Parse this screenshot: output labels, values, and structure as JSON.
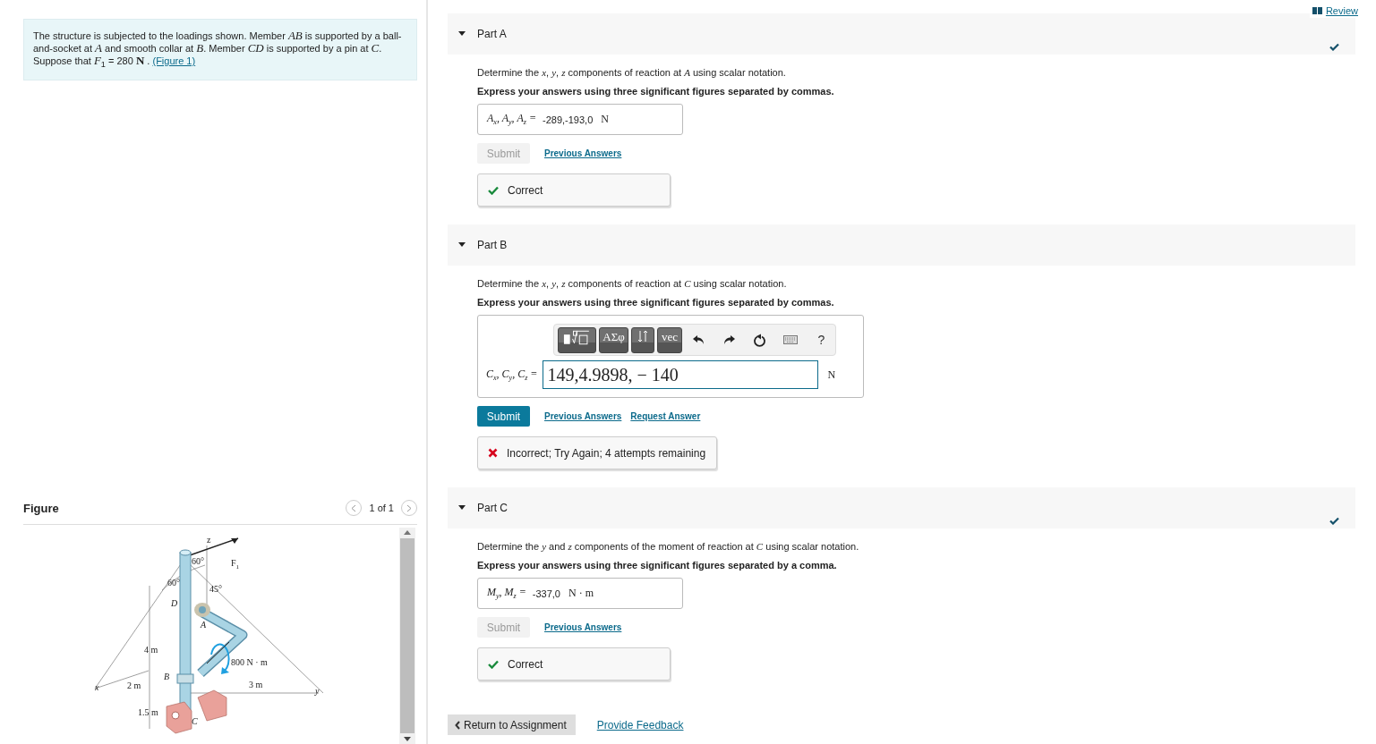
{
  "review": {
    "label": "Review"
  },
  "intro": {
    "text": "The structure is subjected to the loadings shown. Member *AB* is supported by a ball-and-socket at *A* and smooth collar at *B*. Member *CD* is supported by a pin at *C*. Suppose that *F*$_{1}$ = 280 **N** .",
    "link": "(Figure 1)"
  },
  "figure": {
    "title": "Figure",
    "pager": "1 of 1",
    "labels": [
      "z",
      "60°",
      "F$_{1}$",
      "60°",
      "45°",
      "*D*",
      "*A*",
      "4 m",
      "800 N · m",
      "*B*",
      "*x*",
      "2 m",
      "3 m",
      "*y*",
      "1.5 m",
      "*C*"
    ]
  },
  "parts": [
    {
      "title": "Part A",
      "expanded": true,
      "complete": true,
      "prompt": "Determine the *x*, *y*, *z* components of reaction at *A* using scalar notation.",
      "instruction": "Express your answers using three significant figures separated by commas.",
      "answer": {
        "kind": "static",
        "label": "*A*$_{x}$, *A*$_{y}$, *A*$_{z}$ =",
        "value": "-289,-193,0",
        "unit": "N"
      },
      "submit": {
        "label": "Submit",
        "disabled": true
      },
      "links": [
        "Previous Answers"
      ],
      "feedback": {
        "kind": "correct",
        "text": "Correct"
      }
    },
    {
      "title": "Part B",
      "expanded": true,
      "complete": false,
      "prompt": "Determine the *x*, *y*, *z* components of reaction at *C* using scalar notation.",
      "instruction": "Express your answers using three significant figures separated by commas.",
      "answer": {
        "kind": "editor",
        "label": "*C*$_{x}$, *C*$_{y}$, *C*$_{z}$ =",
        "value": "149,4.9898, − 140",
        "unit": "N",
        "toolbar": [
          {
            "kind": "templates"
          },
          {
            "kind": "key",
            "label": "ΑΣφ"
          },
          {
            "kind": "arrows"
          },
          {
            "kind": "key",
            "label": "vec"
          },
          {
            "kind": "undo"
          },
          {
            "kind": "redo"
          },
          {
            "kind": "reset"
          },
          {
            "kind": "keyboard"
          },
          {
            "kind": "plain",
            "label": "?"
          }
        ]
      },
      "submit": {
        "label": "Submit",
        "disabled": false
      },
      "links": [
        "Previous Answers",
        "Request Answer"
      ],
      "feedback": {
        "kind": "incorrect",
        "text": "Incorrect; Try Again; 4 attempts remaining"
      }
    },
    {
      "title": "Part C",
      "expanded": true,
      "complete": true,
      "prompt": "Determine the *y* and *z* components of the moment of reaction at *C* using scalar notation.",
      "instruction": "Express your answers using three significant figures separated by a comma.",
      "answer": {
        "kind": "static",
        "label": "*M*$_{y}$, *M*$_{z}$ =",
        "value": "-337,0",
        "unit": "N · m"
      },
      "submit": {
        "label": "Submit",
        "disabled": true
      },
      "links": [
        "Previous Answers"
      ],
      "feedback": {
        "kind": "correct",
        "text": "Correct"
      }
    }
  ],
  "footer": {
    "back": "Return to Assignment",
    "feedback": "Provide Feedback"
  }
}
